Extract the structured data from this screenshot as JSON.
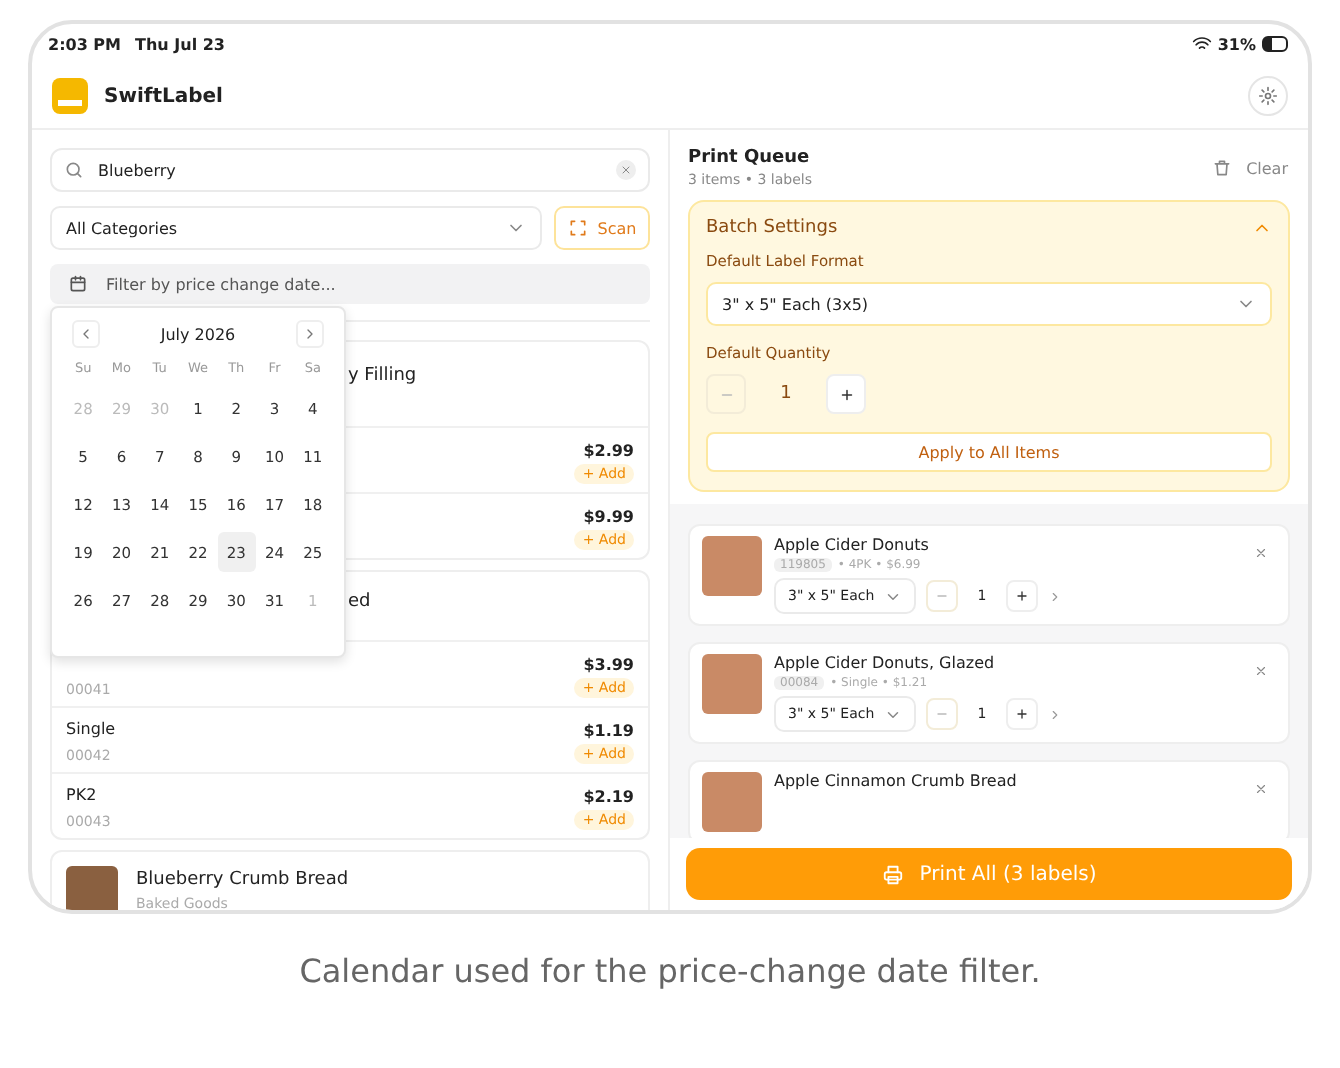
{
  "status_bar": {
    "time": "2:03 PM",
    "date": "Thu Jul 23",
    "battery": "31%"
  },
  "app": {
    "title": "SwiftLabel"
  },
  "search": {
    "value": "Blueberry"
  },
  "category_select": {
    "value": "All Categories"
  },
  "scan_button": {
    "label": "Scan"
  },
  "date_filter": {
    "placeholder": "Filter by price change date..."
  },
  "calendar": {
    "month": "July 2026",
    "weekdays": [
      "Su",
      "Mo",
      "Tu",
      "We",
      "Th",
      "Fr",
      "Sa"
    ],
    "days": [
      {
        "label": "28",
        "outside": true,
        "selected": false
      },
      {
        "label": "29",
        "outside": true,
        "selected": false
      },
      {
        "label": "30",
        "outside": true,
        "selected": false
      },
      {
        "label": "1",
        "outside": false,
        "selected": false
      },
      {
        "label": "2",
        "outside": false,
        "selected": false
      },
      {
        "label": "3",
        "outside": false,
        "selected": false
      },
      {
        "label": "4",
        "outside": false,
        "selected": false
      },
      {
        "label": "5",
        "outside": false,
        "selected": false
      },
      {
        "label": "6",
        "outside": false,
        "selected": false
      },
      {
        "label": "7",
        "outside": false,
        "selected": false
      },
      {
        "label": "8",
        "outside": false,
        "selected": false
      },
      {
        "label": "9",
        "outside": false,
        "selected": false
      },
      {
        "label": "10",
        "outside": false,
        "selected": false
      },
      {
        "label": "11",
        "outside": false,
        "selected": false
      },
      {
        "label": "12",
        "outside": false,
        "selected": false
      },
      {
        "label": "13",
        "outside": false,
        "selected": false
      },
      {
        "label": "14",
        "outside": false,
        "selected": false
      },
      {
        "label": "15",
        "outside": false,
        "selected": false
      },
      {
        "label": "16",
        "outside": false,
        "selected": false
      },
      {
        "label": "17",
        "outside": false,
        "selected": false
      },
      {
        "label": "18",
        "outside": false,
        "selected": false
      },
      {
        "label": "19",
        "outside": false,
        "selected": false
      },
      {
        "label": "20",
        "outside": false,
        "selected": false
      },
      {
        "label": "21",
        "outside": false,
        "selected": false
      },
      {
        "label": "22",
        "outside": false,
        "selected": false
      },
      {
        "label": "23",
        "outside": false,
        "selected": true
      },
      {
        "label": "24",
        "outside": false,
        "selected": false
      },
      {
        "label": "25",
        "outside": false,
        "selected": false
      },
      {
        "label": "26",
        "outside": false,
        "selected": false
      },
      {
        "label": "27",
        "outside": false,
        "selected": false
      },
      {
        "label": "28",
        "outside": false,
        "selected": false
      },
      {
        "label": "29",
        "outside": false,
        "selected": false
      },
      {
        "label": "30",
        "outside": false,
        "selected": false
      },
      {
        "label": "31",
        "outside": false,
        "selected": false
      },
      {
        "label": "1",
        "outside": true,
        "selected": false
      }
    ]
  },
  "products": [
    {
      "title": "y Filling",
      "variants": [
        {
          "price": "$2.99",
          "add": "+ Add"
        },
        {
          "price": "$9.99",
          "add": "+ Add"
        }
      ]
    },
    {
      "title": "ed",
      "variants": [
        {
          "code": "00041",
          "price": "$3.99",
          "add": "+ Add"
        },
        {
          "name": "Single",
          "code": "00042",
          "price": "$1.19",
          "add": "+ Add"
        },
        {
          "name": "PK2",
          "code": "00043",
          "price": "$2.19",
          "add": "+ Add"
        }
      ]
    },
    {
      "title": "Blueberry Crumb Bread",
      "category": "Baked Goods"
    }
  ],
  "print_queue": {
    "title": "Print Queue",
    "summary": "3 items • 3 labels",
    "clear": "Clear"
  },
  "batch_settings": {
    "title": "Batch Settings",
    "expanded": true,
    "format_label": "Default Label Format",
    "format": "3\" x 5\" Each (3x5)",
    "quantity_label": "Default Quantity",
    "quantity": "1",
    "apply": "Apply to All Items"
  },
  "queue_items": [
    {
      "name": "Apple Cider Donuts",
      "code": "119805",
      "details": "• 4PK • $6.99",
      "format": "3\" x 5\" Each",
      "quantity": "1"
    },
    {
      "name": "Apple Cider Donuts, Glazed",
      "code": "00084",
      "details": "• Single • $1.21",
      "format": "3\" x 5\" Each",
      "quantity": "1"
    },
    {
      "name": "Apple Cinnamon Crumb Bread"
    }
  ],
  "print_button": {
    "label": "Print All (3 labels)"
  },
  "caption": "Calendar used for the price-change date filter."
}
